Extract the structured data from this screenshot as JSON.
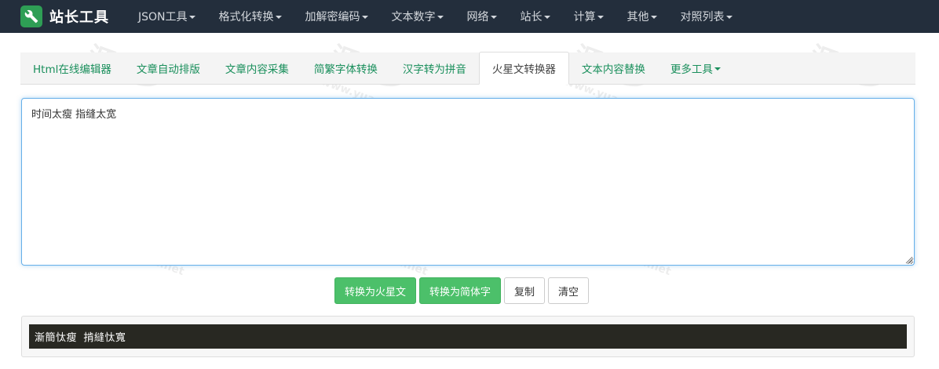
{
  "navbar": {
    "brand_name": "站长工具",
    "brand_icon": "wrench-icon",
    "items": [
      {
        "label": "JSON工具"
      },
      {
        "label": "格式化转换"
      },
      {
        "label": "加解密编码"
      },
      {
        "label": "文本数字"
      },
      {
        "label": "网络"
      },
      {
        "label": "站长"
      },
      {
        "label": "计算"
      },
      {
        "label": "其他"
      },
      {
        "label": "对照列表"
      }
    ]
  },
  "tabs": [
    {
      "label": "Html在线编辑器"
    },
    {
      "label": "文章自动排版"
    },
    {
      "label": "文章内容采集"
    },
    {
      "label": "简繁字体转换"
    },
    {
      "label": "汉字转为拼音"
    },
    {
      "label": "火星文转换器",
      "active": true
    },
    {
      "label": "文本内容替换"
    },
    {
      "label": "更多工具"
    }
  ],
  "editor": {
    "value": "时间太瘦 指缝太宽"
  },
  "buttons": {
    "to_martian": "转换为火星文",
    "to_simplified": "转换为简体字",
    "copy": "复制",
    "clear": "清空"
  },
  "output": {
    "text": "澵簡忲瘦 掯縫忲寬"
  },
  "watermark": {
    "text": "源多多",
    "url": "www.yuanddd.net"
  },
  "colors": {
    "navbar_bg": "#232e3c",
    "brand_green": "#2e9e55",
    "tab_link": "#1a8f5c",
    "button_green": "#4cc06a",
    "output_bg": "#282822"
  }
}
